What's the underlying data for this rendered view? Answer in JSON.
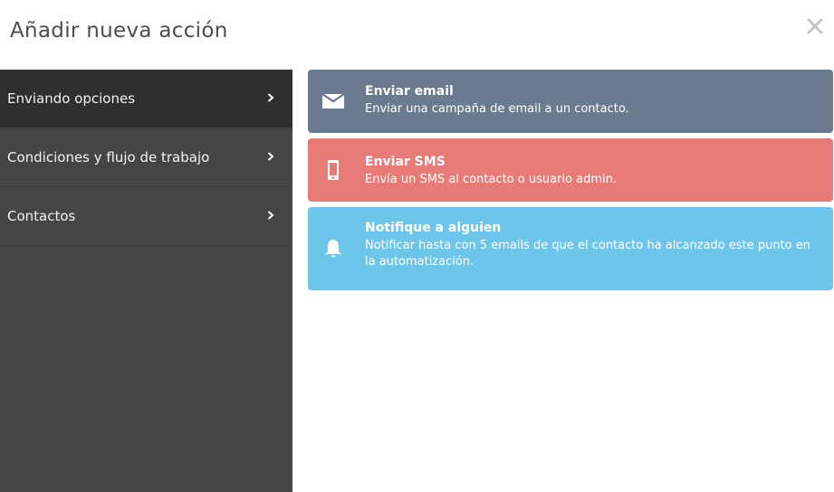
{
  "modal": {
    "title": "Añadir nueva acción",
    "close_icon": "close-icon"
  },
  "sidebar": {
    "items": [
      {
        "label": "Enviando opciones",
        "active": true,
        "icon": "chevron-right-icon"
      },
      {
        "label": "Condiciones y flujo de trabajo",
        "active": false,
        "icon": "chevron-right-icon"
      },
      {
        "label": "Contactos",
        "active": false,
        "icon": "chevron-right-icon"
      }
    ]
  },
  "actions": [
    {
      "title": "Enviar email",
      "description": "Enviar una campaña de email a un contacto.",
      "icon": "envelope-icon",
      "color": "#6a7a8f"
    },
    {
      "title": "Enviar SMS",
      "description": "Envía un SMS al contacto o usuario admin.",
      "icon": "mobile-phone-icon",
      "color": "#e77b77"
    },
    {
      "title": "Notifique a alguien",
      "description": "Notificar hasta con 5 emails de que el contacto ha alcanzado este punto en la automatización.",
      "icon": "bell-icon",
      "color": "#6ec5ea"
    }
  ],
  "colors": {
    "sidebar_bg": "#454545",
    "sidebar_active": "#2f2f2f",
    "title_text": "#4d4d4d"
  }
}
